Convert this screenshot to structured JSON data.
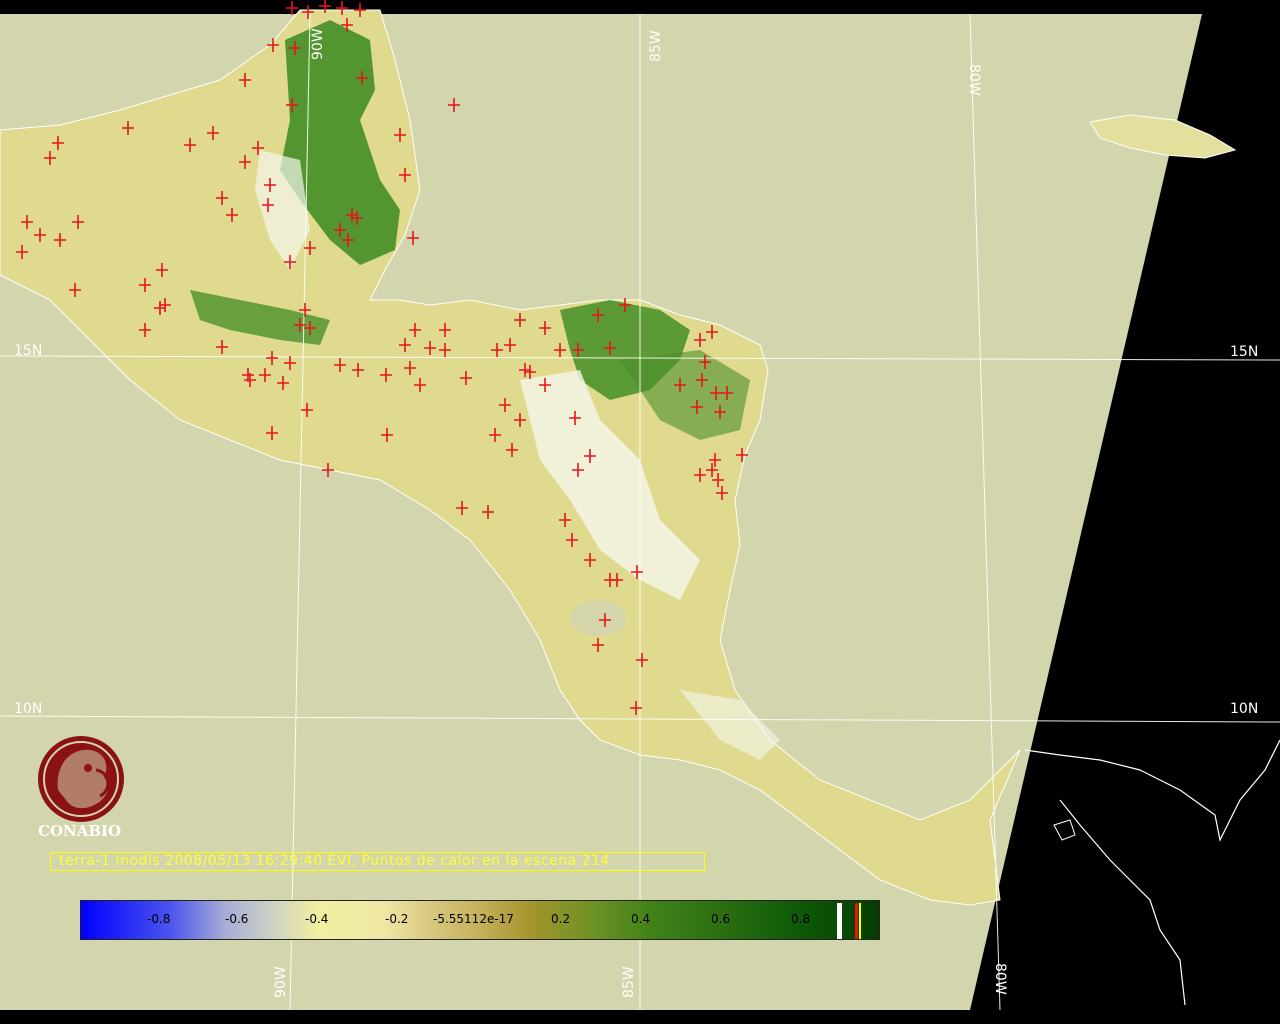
{
  "grid": {
    "lon_labels_top": [
      "90W",
      "85W",
      "80W"
    ],
    "lon_labels_bottom": [
      "90W",
      "85W",
      "80W"
    ],
    "lat_labels_left": [
      "15N",
      "10N"
    ],
    "lat_labels_right": [
      "15N",
      "10N"
    ]
  },
  "logo": {
    "name": "CONABIO",
    "icon": "conabio-macaw-logo-icon"
  },
  "caption": "terra-1 modis 2008/05/13 16:29:40 EVI, Puntos de calor en la escena 214",
  "colorbar": {
    "tick_labels": [
      "-0.8",
      "-0.6",
      "-0.4",
      "-0.2",
      "-5.55112e-17",
      "0.2",
      "0.4",
      "0.6",
      "0.8"
    ]
  },
  "colors": {
    "background_scene": "#d3d5ad",
    "outside_scene": "#000000",
    "hotspot_marker": "#e8141c",
    "grid_lines": "#ffffff",
    "caption_text": "#ffff33",
    "vegetation_dense": "#2f7a19",
    "vegetation_sparse": "#e8e39a",
    "logo_red": "#8b1212"
  }
}
